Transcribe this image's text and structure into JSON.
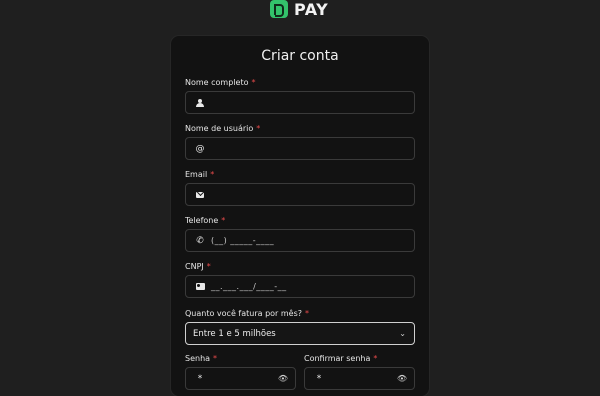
{
  "brand": {
    "name": "PAY"
  },
  "form": {
    "title": "Criar conta",
    "fields": [
      {
        "label": "Nome completo",
        "icon": "person-icon",
        "value": ""
      },
      {
        "label": "Nome de usuário",
        "icon": "at-icon",
        "value": ""
      },
      {
        "label": "Email",
        "icon": "envelope-icon",
        "value": ""
      },
      {
        "label": "Telefone",
        "icon": "phone-icon",
        "placeholder": "(__) _____-____"
      },
      {
        "label": "CNPJ",
        "icon": "id-card-icon",
        "placeholder": "__.___.___/____-__"
      }
    ],
    "revenue": {
      "label": "Quanto você fatura por mês?",
      "selected": "Entre 1 e 5 milhões"
    },
    "password": {
      "label": "Senha",
      "value": "*"
    },
    "confirm_password": {
      "label": "Confirmar senha",
      "value": "*"
    },
    "required_mark": "*"
  },
  "colors": {
    "accent": "#33c26b",
    "required": "#e84b4b",
    "background": "#1f1f1f",
    "card": "#121212"
  }
}
